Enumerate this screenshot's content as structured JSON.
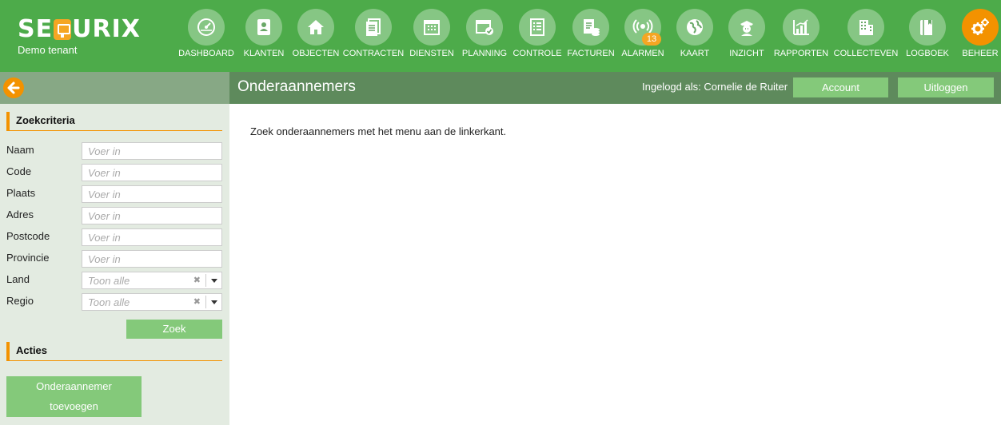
{
  "header": {
    "brand": {
      "pre": "SE",
      "post": "URIX"
    },
    "tenant": "Demo tenant"
  },
  "nav": [
    {
      "key": "dashboard",
      "label": "DASHBOARD",
      "icon": "gauge-icon"
    },
    {
      "key": "klanten",
      "label": "KLANTEN",
      "icon": "contacts-book-icon"
    },
    {
      "key": "objecten",
      "label": "OBJECTEN",
      "icon": "home-icon"
    },
    {
      "key": "contracten",
      "label": "CONTRACTEN",
      "icon": "documents-icon"
    },
    {
      "key": "diensten",
      "label": "DIENSTEN",
      "icon": "calendar-grid-icon"
    },
    {
      "key": "planning",
      "label": "PLANNING",
      "icon": "calendar-check-icon"
    },
    {
      "key": "controle",
      "label": "CONTROLE",
      "icon": "checklist-icon"
    },
    {
      "key": "facturen",
      "label": "FACTUREN",
      "icon": "invoice-coins-icon"
    },
    {
      "key": "alarmen",
      "label": "ALARMEN",
      "icon": "broadcast-icon",
      "badge": "13"
    },
    {
      "key": "kaart",
      "label": "KAART",
      "icon": "globe-icon"
    },
    {
      "key": "inzicht",
      "label": "INZICHT",
      "icon": "guard-icon"
    },
    {
      "key": "rapporten",
      "label": "RAPPORTEN",
      "icon": "bar-chart-icon"
    },
    {
      "key": "collecteven",
      "label": "COLLECTEVEN",
      "icon": "building-icon"
    },
    {
      "key": "logboek",
      "label": "LOGBOEK",
      "icon": "book-icon"
    },
    {
      "key": "beheer",
      "label": "BEHEER",
      "icon": "gears-icon",
      "active": true
    }
  ],
  "subheader": {
    "title": "Onderaannemers",
    "login_info": "Ingelogd als: Cornelie de Ruiter",
    "account_label": "Account",
    "logout_label": "Uitloggen"
  },
  "sidebar": {
    "search_heading": "Zoekcriteria",
    "fields": {
      "naam": {
        "label": "Naam",
        "placeholder": "Voer in"
      },
      "code": {
        "label": "Code",
        "placeholder": "Voer in"
      },
      "plaats": {
        "label": "Plaats",
        "placeholder": "Voer in"
      },
      "adres": {
        "label": "Adres",
        "placeholder": "Voer in"
      },
      "postcode": {
        "label": "Postcode",
        "placeholder": "Voer in"
      },
      "provincie": {
        "label": "Provincie",
        "placeholder": "Voer in"
      },
      "land": {
        "label": "Land",
        "placeholder": "Toon alle"
      },
      "regio": {
        "label": "Regio",
        "placeholder": "Toon alle"
      }
    },
    "clear_glyph": "✖",
    "search_label": "Zoek",
    "actions_heading": "Acties",
    "add_line1": "Onderaannemer",
    "add_line2": "toevoegen"
  },
  "main": {
    "message": "Zoek onderaannemers met het menu aan de linkerkant."
  },
  "colors": {
    "header_green": "#4dab4a",
    "accent_orange": "#f39200",
    "button_green": "#84c97a",
    "sidebar_bg": "#e3ebe1"
  }
}
